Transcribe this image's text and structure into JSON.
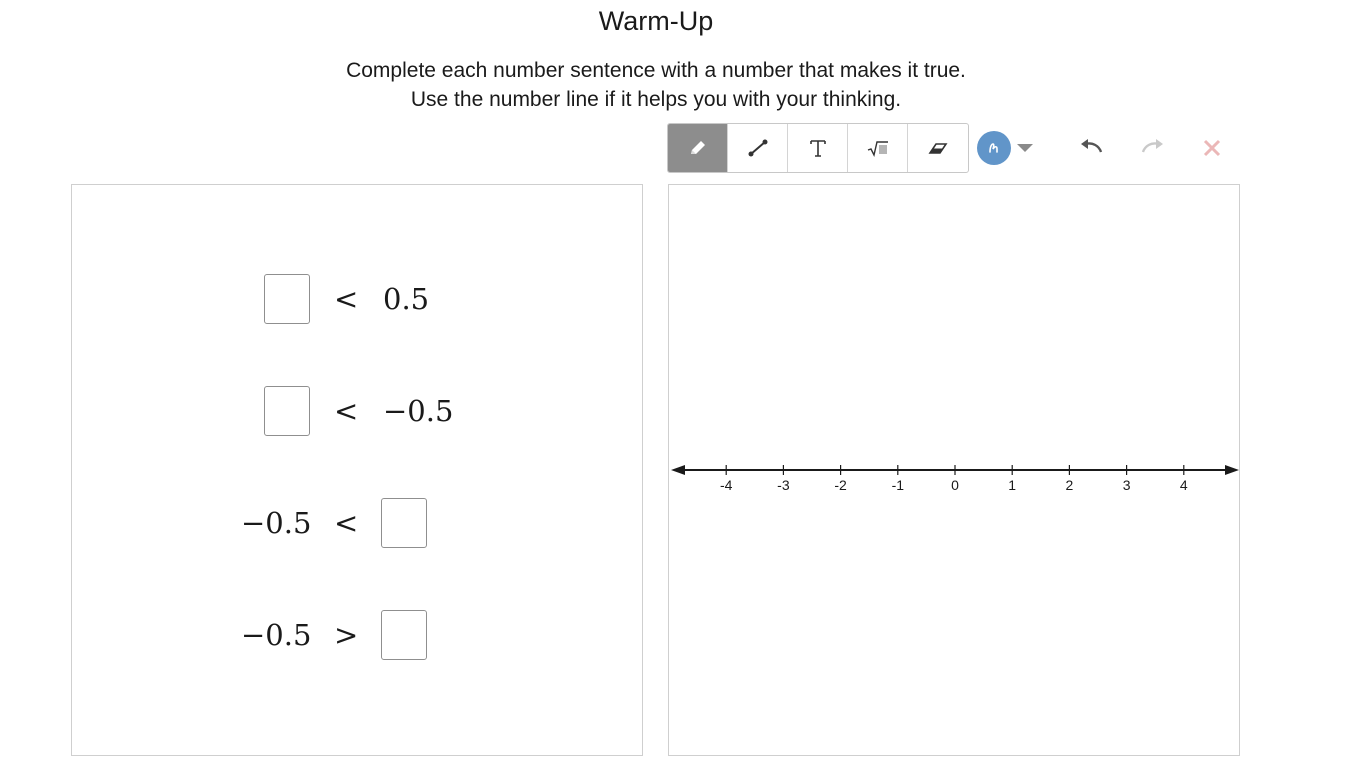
{
  "header": {
    "title": "Warm-Up",
    "instruction_line1": "Complete each number sentence with a number that makes it true.",
    "instruction_line2": "Use the number line if it helps you with your thinking."
  },
  "toolbar": {
    "tools": [
      "pencil-icon",
      "line-segment-icon",
      "text-tool-icon",
      "math-tool-icon",
      "eraser-icon"
    ],
    "active_tool": "pencil-icon",
    "pen_color": "#6195c9",
    "undo_enabled": true,
    "redo_enabled": false,
    "clear_enabled": false
  },
  "sentences": [
    {
      "left": "",
      "operator": "<",
      "right": "0.5",
      "blank": "left"
    },
    {
      "left": "",
      "operator": "<",
      "right": "−0.5",
      "blank": "left"
    },
    {
      "left": "−0.5",
      "operator": "<",
      "right": "",
      "blank": "right"
    },
    {
      "left": "−0.5",
      "operator": ">",
      "right": "",
      "blank": "right"
    }
  ],
  "number_line": {
    "min": -4,
    "max": 4,
    "step": 1,
    "tick_labels": [
      "-4",
      "-3",
      "-2",
      "-1",
      "0",
      "1",
      "2",
      "3",
      "4"
    ]
  }
}
